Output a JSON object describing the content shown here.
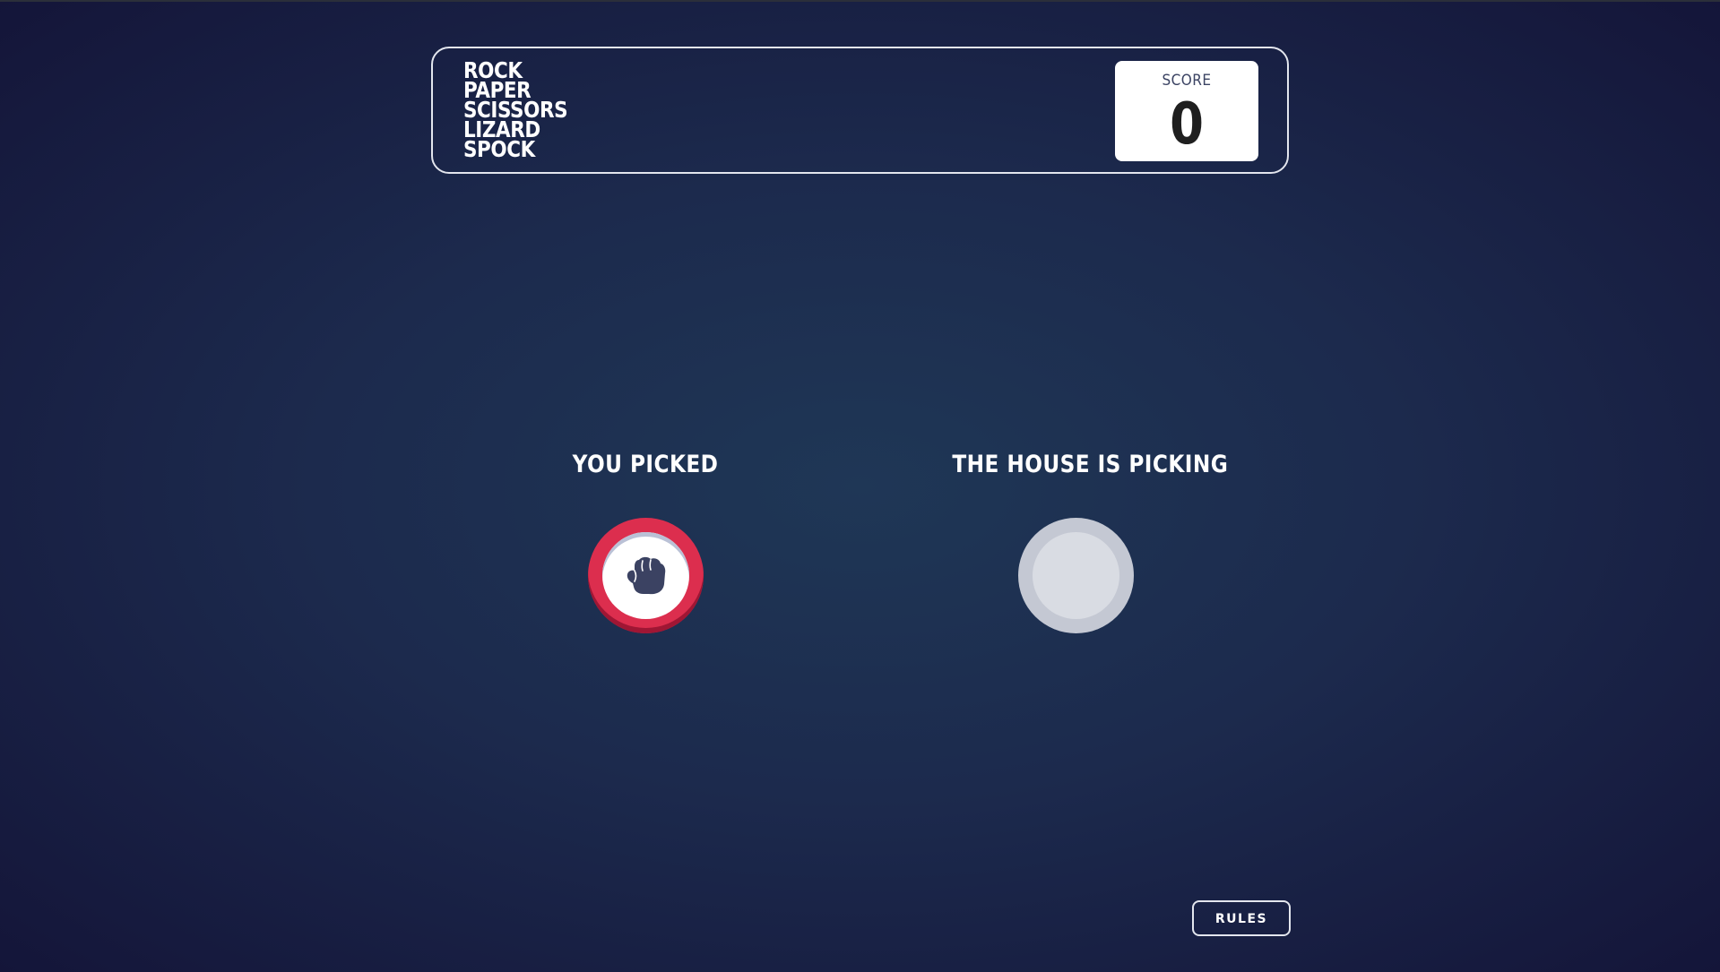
{
  "header": {
    "title_lines": [
      "ROCK",
      "PAPER",
      "SCISSORS",
      "LIZARD",
      "SPOCK"
    ],
    "score_label": "SCORE",
    "score_value": "0"
  },
  "picks": {
    "you_label": "YOU PICKED",
    "you_choice": "rock",
    "you_icon": "rock-icon",
    "you_color": "#dc2e4e",
    "house_label": "THE HOUSE IS PICKING"
  },
  "footer": {
    "rules_label": "RULES"
  }
}
